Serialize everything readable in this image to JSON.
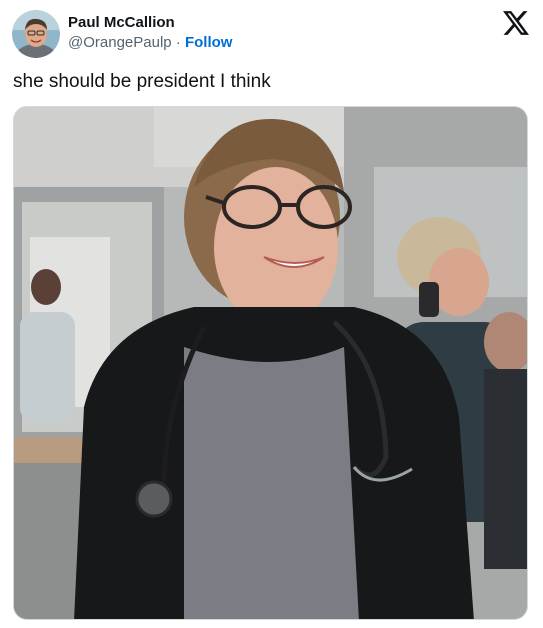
{
  "author": {
    "display_name": "Paul McCallion",
    "handle": "@OrangePaulp",
    "separator": "·",
    "follow_label": "Follow"
  },
  "tweet": {
    "text": "she should be president I think"
  },
  "icons": {
    "platform_logo": "x-logo-icon",
    "avatar": "avatar-image"
  },
  "media": {
    "type": "photo",
    "description_icon": "photo-image"
  },
  "colors": {
    "text_primary": "#0f1419",
    "text_secondary": "#536471",
    "link": "#006fd6",
    "border": "#cfd9de",
    "background": "#ffffff"
  }
}
